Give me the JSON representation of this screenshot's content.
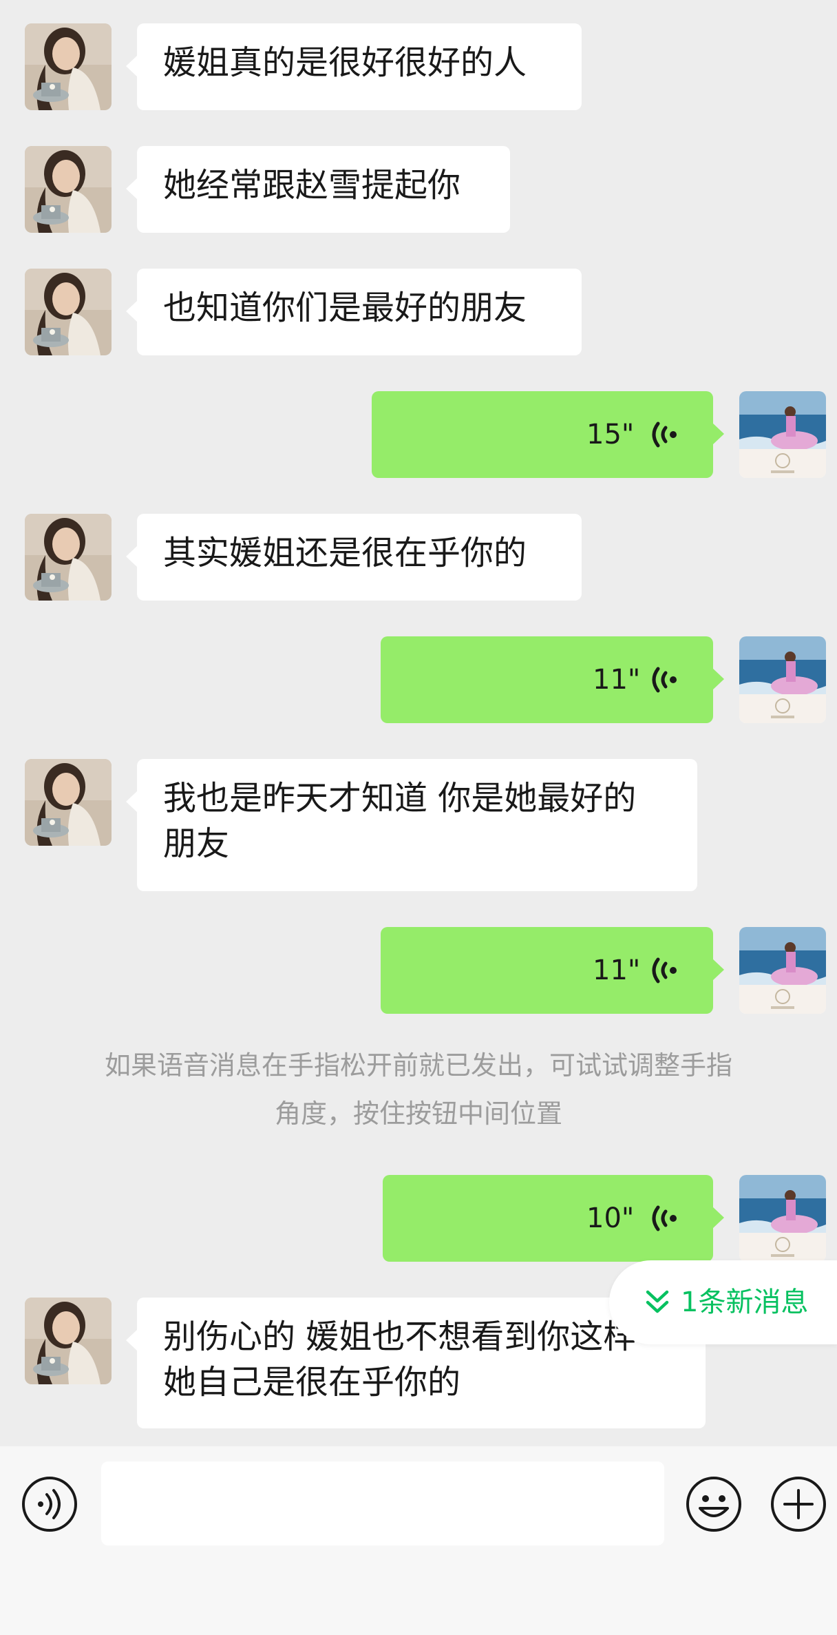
{
  "messages": [
    {
      "type": "text",
      "direction": "incoming",
      "text": "媛姐真的是很好很好的人"
    },
    {
      "type": "text",
      "direction": "incoming",
      "text": "她经常跟赵雪提起你"
    },
    {
      "type": "text",
      "direction": "incoming",
      "text": "也知道你们是最好的朋友"
    },
    {
      "type": "voice",
      "direction": "outgoing",
      "duration": "15\""
    },
    {
      "type": "text",
      "direction": "incoming",
      "text": "其实媛姐还是很在乎你的"
    },
    {
      "type": "voice",
      "direction": "outgoing",
      "duration": "11\""
    },
    {
      "type": "text",
      "direction": "incoming",
      "lines": [
        "我也是昨天才知道 你是她最好的",
        "朋友"
      ]
    },
    {
      "type": "voice",
      "direction": "outgoing",
      "duration": "11\""
    },
    {
      "type": "voice",
      "direction": "outgoing",
      "duration": "10\""
    },
    {
      "type": "text",
      "direction": "incoming",
      "lines": [
        "别伤心的 媛姐也不想看到你这样",
        "她自己是很在乎你的"
      ]
    }
  ],
  "system_notice": {
    "lines": [
      "如果语音消息在手指松开前就已发出，可试试调整手指",
      "角度，按住按钮中间位置"
    ]
  },
  "new_message_pill": {
    "label": "1条新消息",
    "icon": "double-chevron-down-icon"
  },
  "input_bar": {
    "voice_button_icon": "voice-input-icon",
    "emoji_button_icon": "emoji-icon",
    "more_button_icon": "plus-icon",
    "text_value": ""
  },
  "colors": {
    "background": "#ededed",
    "incoming_bubble": "#ffffff",
    "outgoing_bubble": "#95ec69",
    "accent": "#07c160",
    "notice_text": "#9c9c9c"
  }
}
